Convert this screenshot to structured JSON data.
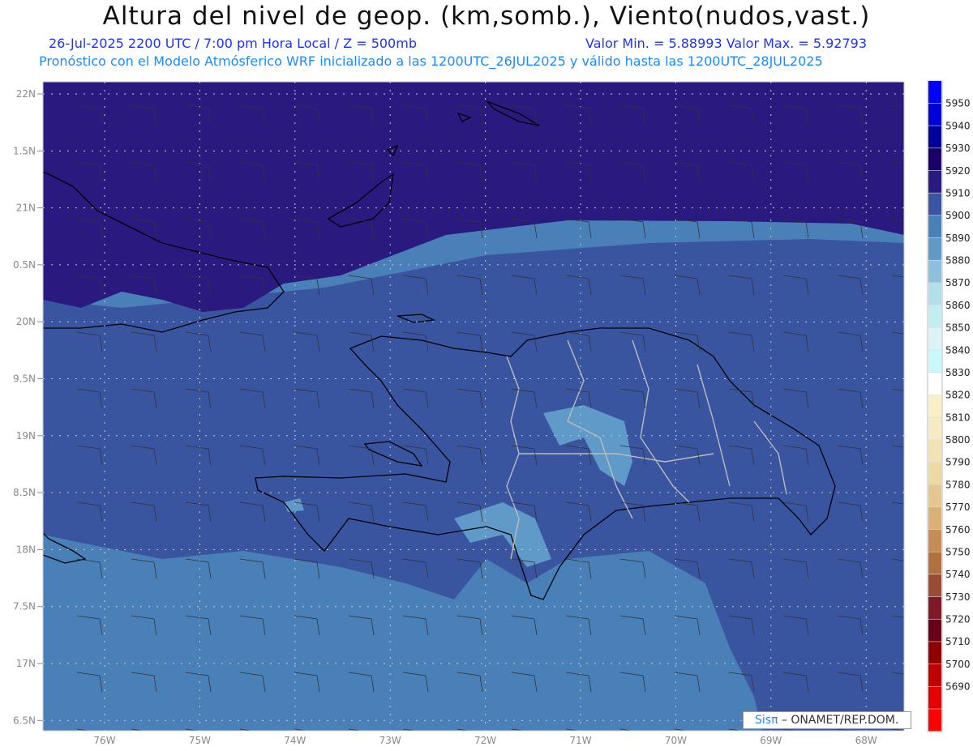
{
  "header": {
    "title": "Altura del nivel de geop. (km,somb.), Viento(nudos,vast.)",
    "subtitle_left": "26-Jul-2025   2200 UTC / 7:00 pm Hora Local / Z = 500mb",
    "subtitle_right": "Valor Min. = 5.88993   Valor Max. = 5.92793",
    "model_info": "Pronóstico con el Modelo Atmósferico WRF inicializado a las 1200UTC_26JUL2025 y válido hasta las  1200UTC_28JUL2025"
  },
  "axes": {
    "lat_labels": [
      "22N",
      "1.5N",
      "21N",
      "0.5N",
      "20N",
      "9.5N",
      "19N",
      "8.5N",
      "18N",
      "7.5N",
      "17N",
      "6.5N"
    ],
    "lon_labels": [
      "76W",
      "75W",
      "74W",
      "73W",
      "72W",
      "71W",
      "70W",
      "69W",
      "68W"
    ]
  },
  "colorbar": {
    "labels": [
      "5950",
      "5940",
      "5930",
      "5920",
      "5910",
      "5900",
      "5890",
      "5880",
      "5870",
      "5860",
      "5850",
      "5840",
      "5830",
      "5820",
      "5810",
      "5800",
      "5790",
      "5780",
      "5770",
      "5760",
      "5750",
      "5740",
      "5730",
      "5720",
      "5710",
      "5700",
      "5690"
    ],
    "colors": [
      "#0000ff",
      "#0000d8",
      "#00009a",
      "#1a0068",
      "#2a1a80",
      "#3a55a0",
      "#4a80b8",
      "#5f9ac8",
      "#8ec0dc",
      "#b2dfea",
      "#c4edf2",
      "#dcf4f8",
      "#c8fafc",
      "#ffffff",
      "#f8f0c8",
      "#f6ebc4",
      "#f2e2b4",
      "#eed8a4",
      "#e4c690",
      "#d8b078",
      "#c48c58",
      "#b07040",
      "#984c34",
      "#801828",
      "#680018",
      "#900000",
      "#c00000",
      "#e40000",
      "#ff0000"
    ]
  },
  "fill_colors": {
    "dark": "#2a1a80",
    "mid": "#3a55a0",
    "light": "#4a80b8",
    "lighter": "#5f9ac8"
  },
  "credit": {
    "logo": "Sisπ",
    "text": "– ONAMET/REP.DOM."
  }
}
